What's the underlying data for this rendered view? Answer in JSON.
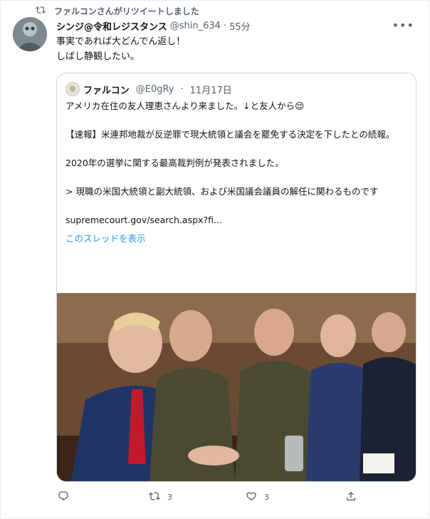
{
  "retweet_banner": {
    "text": "ファルコンさんがリツイートしました"
  },
  "tweet": {
    "author_name": "シンジ@令和レジスタンス",
    "handle": "@shin_634",
    "separator": "·",
    "time": "55分",
    "text": "事実であれば大どんでん返し！\nしばし静観したい。"
  },
  "quoted_tweet": {
    "author_name": "ファルコン",
    "handle": "@E0gRy",
    "separator": "·",
    "date": "11月17日",
    "paragraphs": [
      "アメリカ在住の友人理恵さんより来ました。↓と友人から😌",
      "【速報】米連邦地裁が反逆罪で現大統領と議会を罷免する決定を下したとの続報。",
      "2020年の選挙に関する最高裁判例が発表されました。",
      "> 現職の米国大統領と副大統領、および米国議会議員の解任に関わるものです",
      "supremecourt.gov/search.aspx?fi..."
    ],
    "show_thread": "このスレッドを表示"
  },
  "actions": {
    "reply_count": "",
    "retweet_count": "3",
    "like_count": "3"
  },
  "colors": {
    "link": "#1d9bf0",
    "muted": "#536471",
    "border": "#cfd9de"
  }
}
